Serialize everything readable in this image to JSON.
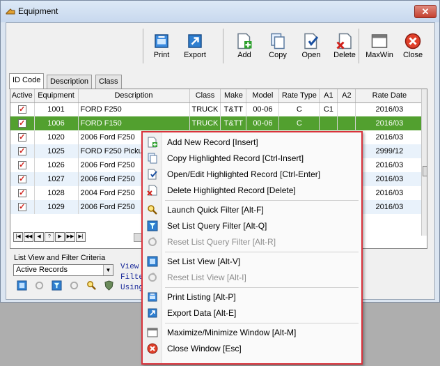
{
  "window": {
    "title": "Equipment"
  },
  "toolbar": [
    {
      "id": "print",
      "label": "Print",
      "icon": "print-icon"
    },
    {
      "id": "export",
      "label": "Export",
      "icon": "export-icon"
    },
    {
      "id": "add",
      "label": "Add",
      "icon": "add-record-icon"
    },
    {
      "id": "copy",
      "label": "Copy",
      "icon": "copy-icon"
    },
    {
      "id": "open",
      "label": "Open",
      "icon": "open-icon"
    },
    {
      "id": "delete",
      "label": "Delete",
      "icon": "delete-icon"
    },
    {
      "id": "maxwin",
      "label": "MaxWin",
      "icon": "maxwin-icon"
    },
    {
      "id": "close",
      "label": "Close",
      "icon": "close-icon"
    }
  ],
  "tabs": [
    "ID Code",
    "Description",
    "Class"
  ],
  "grid": {
    "columns": [
      "Active",
      "Equipment",
      "Description",
      "Class",
      "Make",
      "Model",
      "Rate Type",
      "A1",
      "A2",
      "Rate Date"
    ],
    "rows": [
      [
        "✓",
        "1001",
        "FORD F250",
        "TRUCK",
        "T&TT",
        "00-06",
        "C",
        "C1",
        "",
        "2016/03"
      ],
      [
        "✓",
        "1006",
        "FORD F150",
        "TRUCK",
        "T&TT",
        "00-06",
        "C",
        "",
        "",
        "2016/03"
      ],
      [
        "✓",
        "1020",
        "2006 Ford F250",
        "",
        "",
        "",
        "",
        "",
        "",
        "2016/03"
      ],
      [
        "✓",
        "1025",
        "FORD F250 Pickup",
        "",
        "",
        "",
        "",
        "",
        "",
        "2999/12"
      ],
      [
        "✓",
        "1026",
        "2006 Ford F250",
        "",
        "",
        "",
        "",
        "",
        "",
        "2016/03"
      ],
      [
        "✓",
        "1027",
        "2006 Ford F250",
        "",
        "",
        "",
        "",
        "",
        "",
        "2016/03"
      ],
      [
        "✓",
        "1028",
        "2004 Ford F250",
        "",
        "",
        "",
        "",
        "",
        "",
        "2016/03"
      ],
      [
        "✓",
        "1029",
        "2006 Ford F250",
        "",
        "",
        "",
        "",
        "",
        "",
        "2016/03"
      ]
    ],
    "selected_row": 1
  },
  "filter": {
    "label": "List View and Filter Criteria",
    "selected": "Active Records",
    "side_text": [
      "View",
      "Filte",
      "Using"
    ]
  },
  "context_menu": [
    {
      "label": "Add New Record  [Insert]",
      "icon": "add-record-icon",
      "enabled": true
    },
    {
      "label": "Copy Highlighted Record  [Ctrl-Insert]",
      "icon": "copy-icon",
      "enabled": true
    },
    {
      "label": "Open/Edit Highlighted Record  [Ctrl-Enter]",
      "icon": "open-icon",
      "enabled": true
    },
    {
      "label": "Delete Highlighted Record  [Delete]",
      "icon": "delete-icon",
      "enabled": true
    },
    {
      "sep": true
    },
    {
      "label": "Launch Quick Filter  [Alt-F]",
      "icon": "magnifier-icon",
      "enabled": true
    },
    {
      "label": "Set List Query Filter  [Alt-Q]",
      "icon": "query-filter-icon",
      "enabled": true
    },
    {
      "label": "Reset List Query Filter  [Alt-R]",
      "icon": "reset-filter-icon",
      "enabled": false
    },
    {
      "sep": true
    },
    {
      "label": "Set List View  [Alt-V]",
      "icon": "list-view-icon",
      "enabled": true
    },
    {
      "label": "Reset List View  [Alt-I]",
      "icon": "reset-view-icon",
      "enabled": false
    },
    {
      "sep": true
    },
    {
      "label": "Print Listing  [Alt-P]",
      "icon": "print-icon",
      "enabled": true
    },
    {
      "label": "Export Data  [Alt-E]",
      "icon": "export-icon",
      "enabled": true
    },
    {
      "sep": true
    },
    {
      "label": "Maximize/Minimize Window  [Alt-M]",
      "icon": "maxwin-icon",
      "enabled": true
    },
    {
      "label": "Close Window  [Esc]",
      "icon": "close-icon",
      "enabled": true
    }
  ],
  "colors": {
    "selection": "#52a02f",
    "menu_border": "#d9323b",
    "window_bg": "#dbe5f1"
  }
}
